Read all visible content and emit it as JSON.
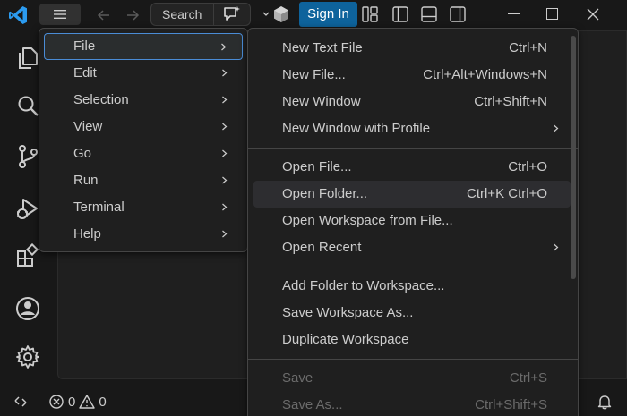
{
  "titlebar": {
    "search_label": "Search",
    "signin_label": "Sign In"
  },
  "main_menu": {
    "items": [
      {
        "label": "File"
      },
      {
        "label": "Edit"
      },
      {
        "label": "Selection"
      },
      {
        "label": "View"
      },
      {
        "label": "Go"
      },
      {
        "label": "Run"
      },
      {
        "label": "Terminal"
      },
      {
        "label": "Help"
      }
    ]
  },
  "file_menu": {
    "group1": [
      {
        "label": "New Text File",
        "key": "Ctrl+N"
      },
      {
        "label": "New File...",
        "key": "Ctrl+Alt+Windows+N"
      },
      {
        "label": "New Window",
        "key": "Ctrl+Shift+N"
      },
      {
        "label": "New Window with Profile",
        "key": ""
      }
    ],
    "group2": [
      {
        "label": "Open File...",
        "key": "Ctrl+O"
      },
      {
        "label": "Open Folder...",
        "key": "Ctrl+K Ctrl+O"
      },
      {
        "label": "Open Workspace from File...",
        "key": ""
      },
      {
        "label": "Open Recent",
        "key": ""
      }
    ],
    "group3": [
      {
        "label": "Add Folder to Workspace...",
        "key": ""
      },
      {
        "label": "Save Workspace As...",
        "key": ""
      },
      {
        "label": "Duplicate Workspace",
        "key": ""
      }
    ],
    "group4": [
      {
        "label": "Save",
        "key": "Ctrl+S"
      },
      {
        "label": "Save As...",
        "key": "Ctrl+Shift+S"
      }
    ]
  },
  "statusbar": {
    "errors": "0",
    "warnings": "0"
  },
  "icons": {
    "logo": "vscode-logo-icon",
    "menu": "hamburger-icon",
    "copilot": "copilot-chat-icon",
    "accounts": "accounts-logo-icon",
    "explorer": "files-icon",
    "search": "search-icon",
    "scm": "source-control-icon",
    "debug": "run-debug-icon",
    "extensions": "extensions-icon",
    "account": "account-icon",
    "settings": "gear-icon",
    "bell": "bell-icon"
  },
  "colors": {
    "accent": "#0e639c",
    "focus_border": "#4a8cd6",
    "background": "#1f1f1f"
  }
}
